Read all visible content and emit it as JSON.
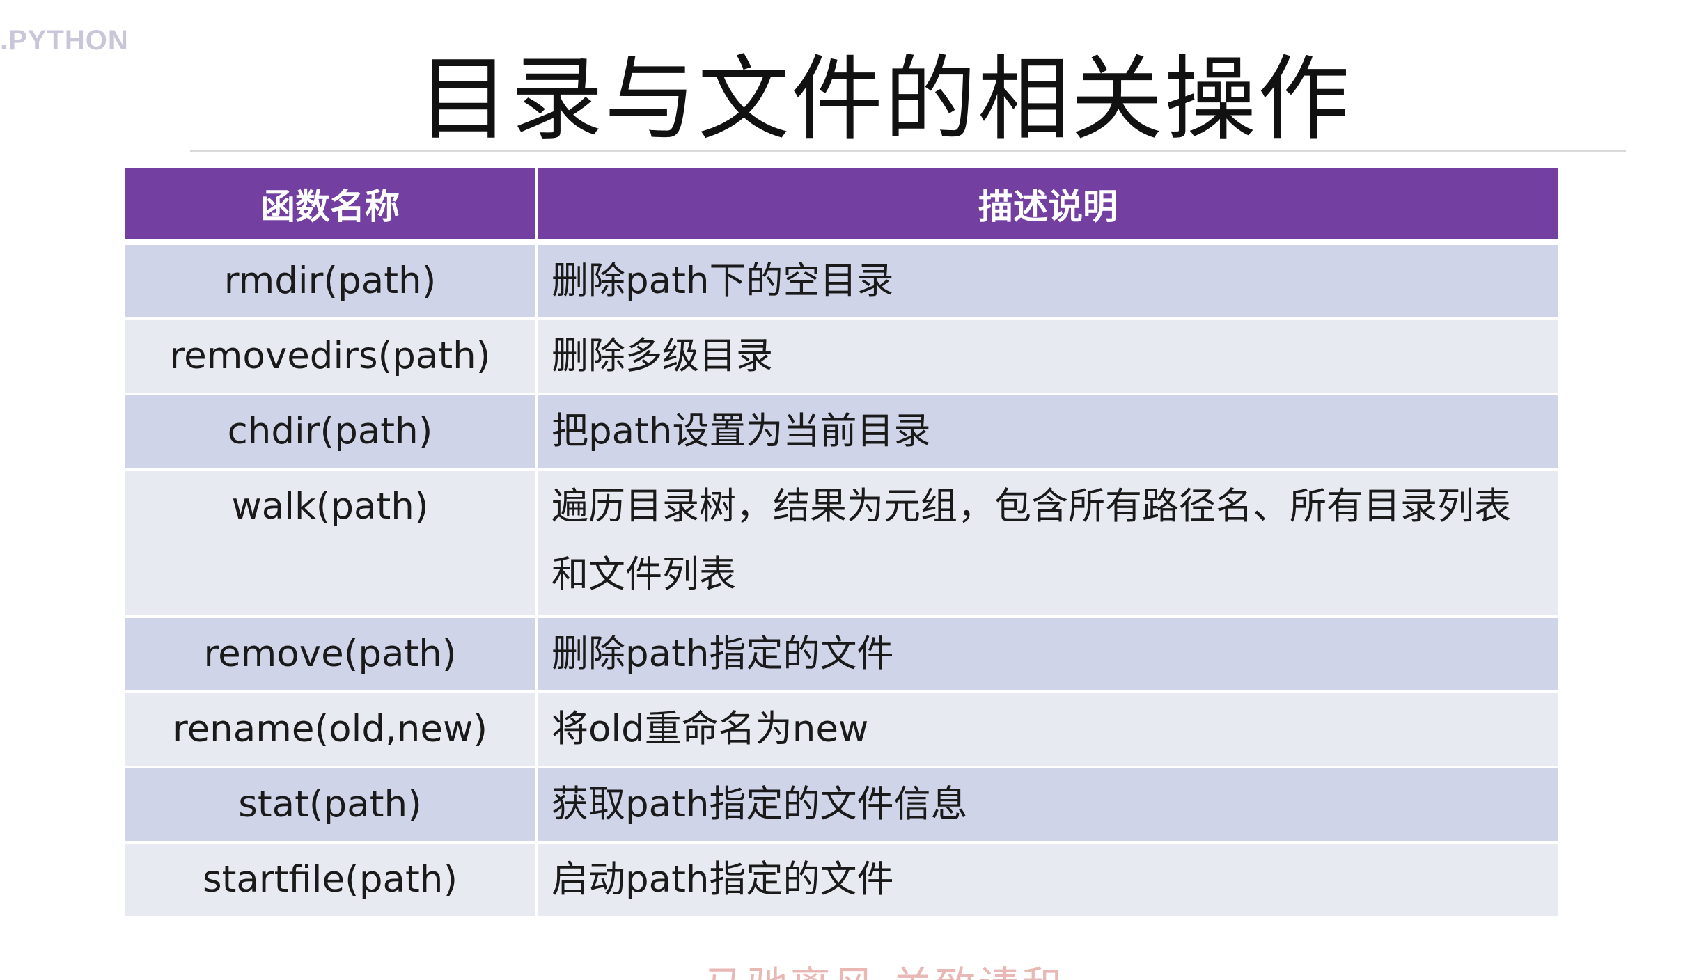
{
  "brand": ".PYTHON",
  "title": "目录与文件的相关操作",
  "table": {
    "headers": [
      "函数名称",
      "描述说明"
    ],
    "rows": [
      {
        "fn": "rmdir(path)",
        "desc": "删除path下的空目录"
      },
      {
        "fn": "removedirs(path)",
        "desc": "删除多级目录"
      },
      {
        "fn": "chdir(path)",
        "desc": "把path设置为当前目录"
      },
      {
        "fn": "walk(path)",
        "desc": "遍历目录树，结果为元组，包含所有路径名、所有目录列表和文件列表"
      },
      {
        "fn": "remove(path)",
        "desc": "删除path指定的文件"
      },
      {
        "fn": "rename(old,new)",
        "desc": "将old重命名为new"
      },
      {
        "fn": "stat(path)",
        "desc": "获取path指定的文件信息"
      },
      {
        "fn": "startfile(path)",
        "desc": "启动path指定的文件"
      }
    ]
  },
  "footer": "马驰离风 关致请和",
  "colors": {
    "header_bg": "#7340a2",
    "row_odd_bg": "#d0d4e9",
    "row_even_bg": "#e8eaf2"
  }
}
